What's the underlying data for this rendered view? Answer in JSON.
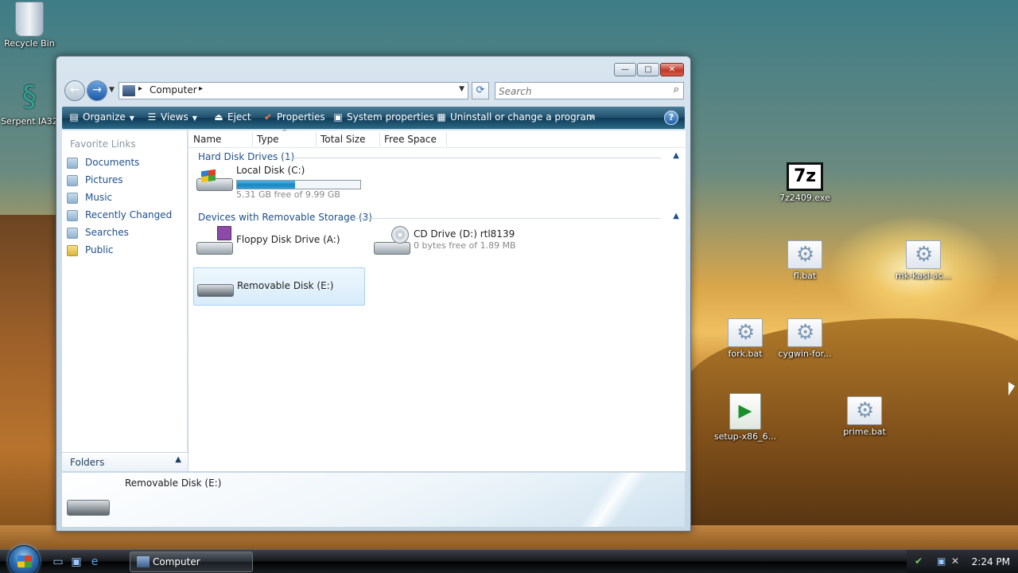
{
  "desktop": {
    "icons": [
      {
        "label": "Recycle Bin",
        "icon": "recycle-bin-icon"
      },
      {
        "label": "Serpent IA32",
        "icon": "serpent-icon"
      },
      {
        "label": "7z2409.exe",
        "icon": "7zip-icon"
      },
      {
        "label": "fl.bat",
        "icon": "batch-file-icon"
      },
      {
        "label": "mk-kasl-ac...",
        "icon": "batch-file-icon"
      },
      {
        "label": "fork.bat",
        "icon": "batch-file-icon"
      },
      {
        "label": "cygwin-for...",
        "icon": "batch-file-icon"
      },
      {
        "label": "setup-x86_6...",
        "icon": "cygwin-setup-icon"
      },
      {
        "label": "prime.bat",
        "icon": "batch-file-icon"
      }
    ],
    "sevenz_glyph": "7z"
  },
  "window": {
    "controls": {
      "minimize": "—",
      "maximize": "□",
      "close": "✕"
    },
    "address": {
      "crumb": "Computer",
      "sep": "▸"
    },
    "search": {
      "placeholder": "Search"
    },
    "toolbar": {
      "organize": "Organize",
      "views": "Views",
      "eject": "Eject",
      "properties": "Properties",
      "system_properties": "System properties",
      "uninstall": "Uninstall or change a program",
      "more": "»",
      "help": "?"
    },
    "nav": {
      "header": "Favorite Links",
      "items": [
        "Documents",
        "Pictures",
        "Music",
        "Recently Changed",
        "Searches",
        "Public"
      ],
      "folders_label": "Folders"
    },
    "columns": [
      "Name",
      "Type",
      "Total Size",
      "Free Space"
    ],
    "groups": [
      {
        "title": "Hard Disk Drives (1)",
        "drives": [
          {
            "name": "Local Disk (C:)",
            "free_text": "5.31 GB free of 9.99 GB",
            "used_fraction": 0.47
          }
        ]
      },
      {
        "title": "Devices with Removable Storage (3)",
        "drives": [
          {
            "name": "Floppy Disk Drive (A:)"
          },
          {
            "name": "CD Drive (D:) rtl8139",
            "free_text": "0 bytes free of 1.89 MB"
          },
          {
            "name": "Removable Disk (E:)",
            "selected": true
          }
        ]
      }
    ],
    "details": {
      "name": "Removable Disk (E:)"
    }
  },
  "taskbar": {
    "task": "Computer",
    "clock": "2:24 PM"
  },
  "colors": {
    "link": "#1e4f8c",
    "command_bar": "#1f4f6c",
    "selection": "#d8ecfa",
    "progress": "#1c86c4"
  }
}
